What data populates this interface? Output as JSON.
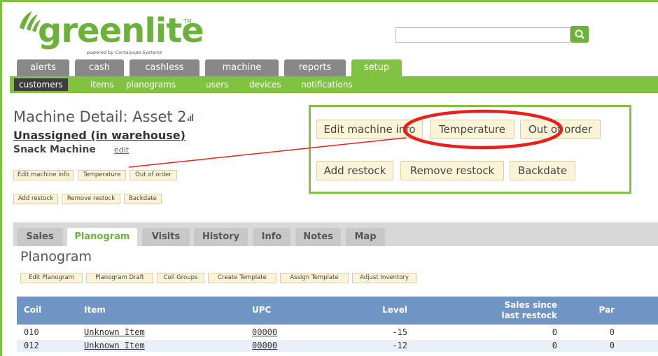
{
  "logo": {
    "text": "greenlite",
    "tm": "TM",
    "powered": "powered by Cantaloupe Systems"
  },
  "search": {
    "placeholder": ""
  },
  "main_tabs": [
    "alerts",
    "cash",
    "cashless",
    "machine",
    "reports",
    "setup"
  ],
  "sub_nav": [
    "customers",
    "items",
    "planograms",
    "users",
    "devices",
    "notifications"
  ],
  "machine": {
    "title": "Machine Detail: Asset 2",
    "location": "Unassigned (in warehouse)",
    "type": "Snack Machine",
    "edit": "edit"
  },
  "actions": {
    "edit_info": "Edit machine info",
    "temperature": "Temperature",
    "out_of_order": "Out of order",
    "add_restock": "Add restock",
    "remove_restock": "Remove restock",
    "backdate": "Backdate"
  },
  "callout_actions": {
    "edit_info": "Edit machine info",
    "temperature": "Temperature",
    "out_of_order": "Out of order",
    "add_restock": "Add restock",
    "remove_restock": "Remove restock",
    "backdate": "Backdate"
  },
  "panel_tabs": [
    "Sales",
    "Planogram",
    "Visits",
    "History",
    "Info",
    "Notes",
    "Map"
  ],
  "planogram": {
    "title": "Planogram",
    "buttons": [
      "Edit Planogram",
      "Planogram Draft",
      "Coil Groups",
      "Create Template",
      "Assign Template",
      "Adjust Inventory"
    ]
  },
  "table": {
    "headers": {
      "coil": "Coil",
      "item": "Item",
      "upc": "UPC",
      "level": "Level",
      "sales_1": "Sales since",
      "sales_2": "last restock",
      "par": "Par"
    },
    "rows": [
      {
        "coil": "010",
        "item": "Unknown Item",
        "upc": "00000",
        "level": "-15",
        "sales": "0",
        "par": "0"
      },
      {
        "coil": "012",
        "item": "Unknown Item",
        "upc": "00000",
        "level": "-12",
        "sales": "0",
        "par": "0"
      }
    ]
  },
  "colors": {
    "brand_green": "#80c341",
    "header_blue": "#6f95c4",
    "annotation_red": "#e8211c"
  }
}
